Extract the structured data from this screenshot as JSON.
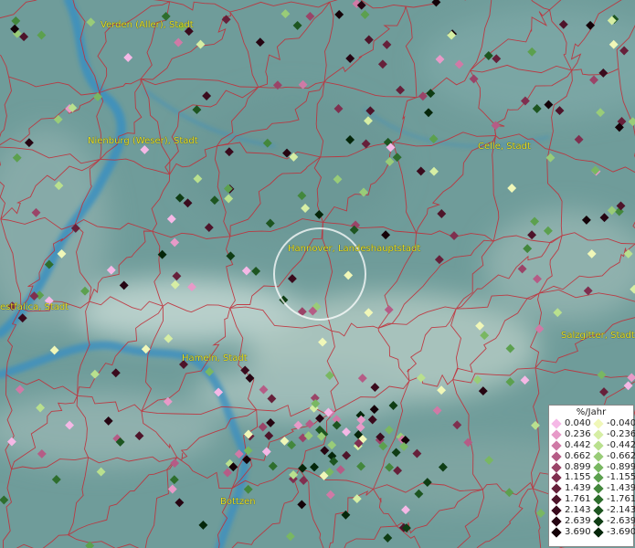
{
  "map": {
    "cities": [
      {
        "name": "Verden (Aller), Stadt"
      },
      {
        "name": "Nienburg (Weser), Stadt"
      },
      {
        "name": "Celle, Stadt"
      },
      {
        "name": "Hannover, Landeshauptstadt"
      },
      {
        "name": "estfalica, Stadt"
      },
      {
        "name": "Hameln, Stadt"
      },
      {
        "name": "Salzgitter, Stadt"
      },
      {
        "name": "Bottzen"
      }
    ],
    "colors": {
      "terrain": "#6f9c9a",
      "river": "#3b8fc0",
      "borders": "#c0303a",
      "labels": "#e8e020"
    }
  },
  "legend": {
    "title": "%/Jahr",
    "positive": [
      {
        "label": "0.040",
        "color": "#f5b8e6"
      },
      {
        "label": "0.236",
        "color": "#e79ac8"
      },
      {
        "label": "0.442",
        "color": "#cf7aa6"
      },
      {
        "label": "0.662",
        "color": "#b55c86"
      },
      {
        "label": "0.899",
        "color": "#9a4468"
      },
      {
        "label": "1.155",
        "color": "#7f2f4f"
      },
      {
        "label": "1.439",
        "color": "#66203a"
      },
      {
        "label": "1.761",
        "color": "#4e142a"
      },
      {
        "label": "2.143",
        "color": "#3a0b1d"
      },
      {
        "label": "2.639",
        "color": "#260512"
      },
      {
        "label": "3.690",
        "color": "#140208"
      }
    ],
    "negative": [
      {
        "label": "-0.040",
        "color": "#f0f7b8"
      },
      {
        "label": "-0.236",
        "color": "#d6eea4"
      },
      {
        "label": "-0.442",
        "color": "#b9e08e"
      },
      {
        "label": "-0.662",
        "color": "#99cc78"
      },
      {
        "label": "-0.899",
        "color": "#79b762"
      },
      {
        "label": "-1.155",
        "color": "#5ca04e"
      },
      {
        "label": "-1.439",
        "color": "#43873c"
      },
      {
        "label": "-1.761",
        "color": "#2e6e2d"
      },
      {
        "label": "-2.143",
        "color": "#1d5520"
      },
      {
        "label": "-2.639",
        "color": "#0f3d14"
      },
      {
        "label": "-3.690",
        "color": "#05260a"
      }
    ]
  }
}
